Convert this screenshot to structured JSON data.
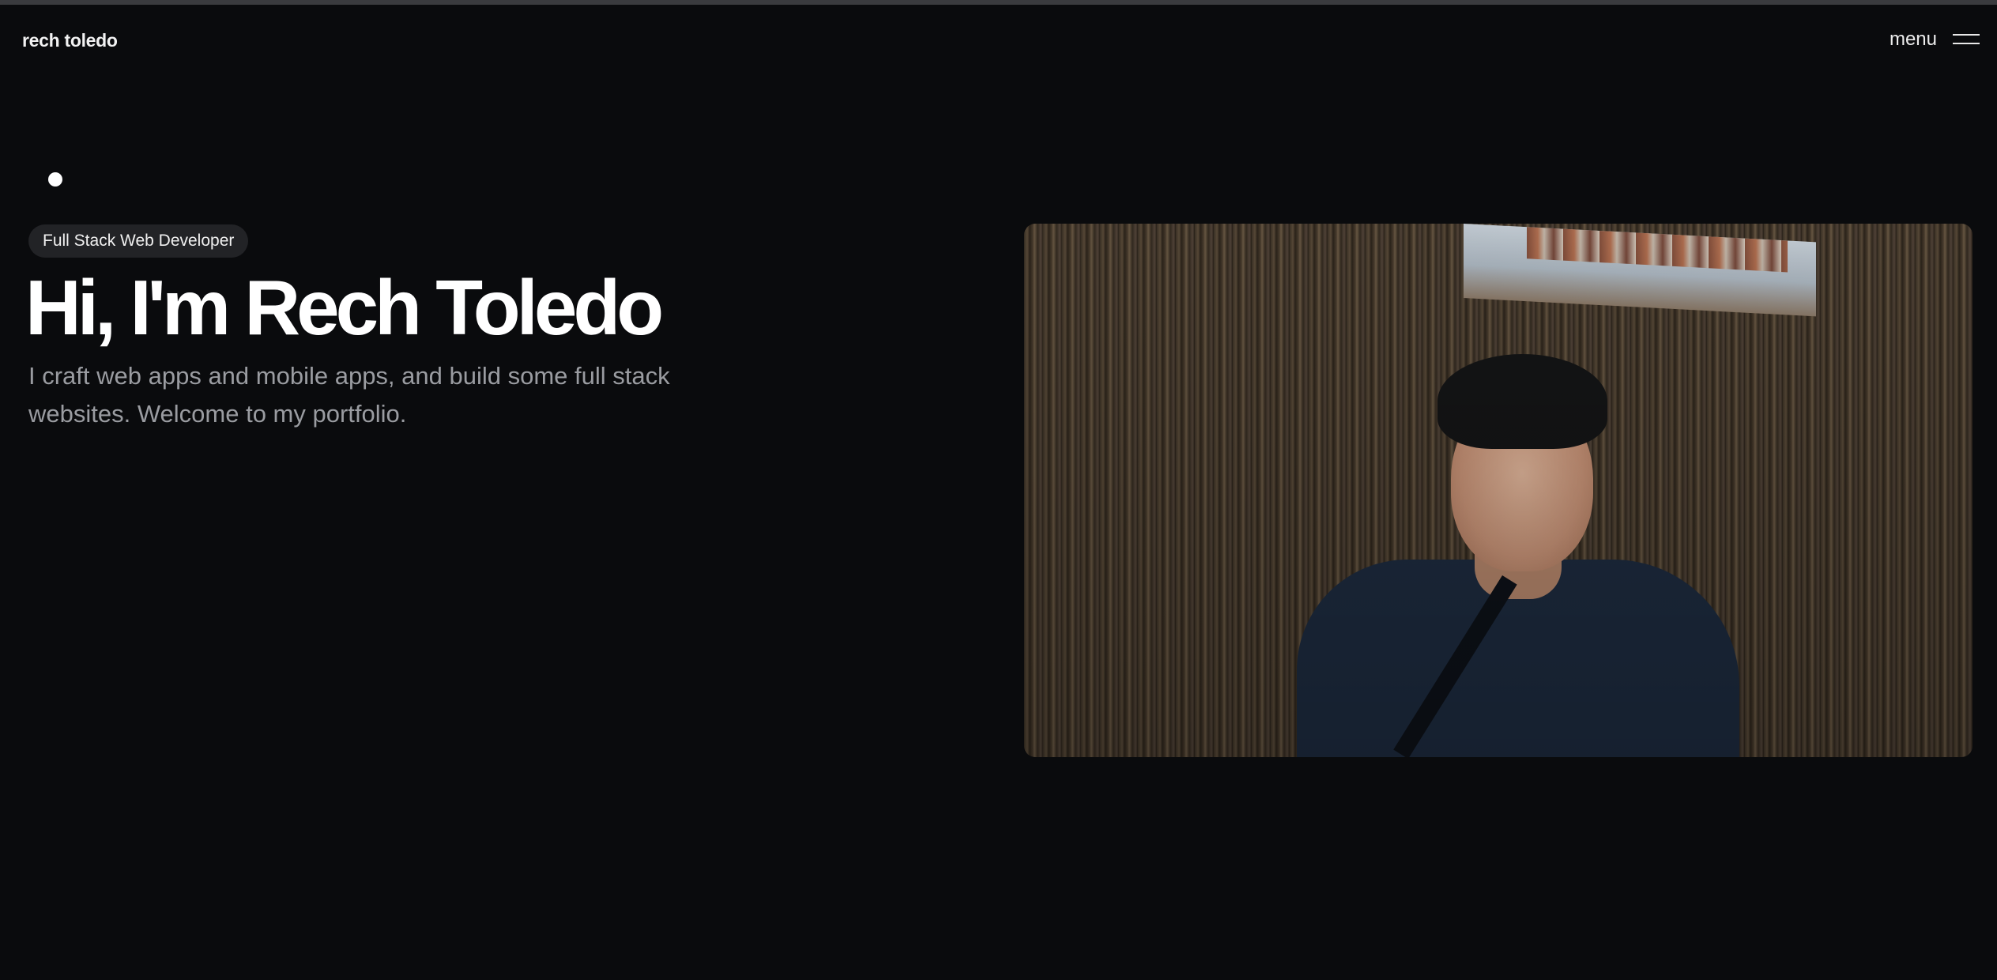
{
  "header": {
    "brand": "rech toledo",
    "menu_label": "menu",
    "menu_icon": "hamburger-icon"
  },
  "hero": {
    "role_badge": "Full Stack Web Developer",
    "title": "Hi, I'm Rech Toledo",
    "subtitle": "I craft web apps and mobile apps, and build some full stack websites. Welcome to my portfolio.",
    "photo_alt": "Portrait of Rech Toledo"
  },
  "colors": {
    "background": "#0a0b0d",
    "text": "#ffffff",
    "muted_text": "#9a9ca1",
    "pill_background": "#222326"
  }
}
